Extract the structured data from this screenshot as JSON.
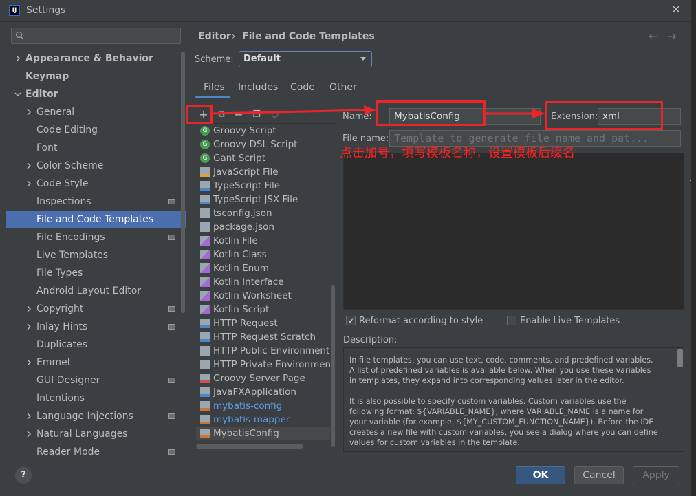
{
  "window": {
    "title": "Settings",
    "app_icon_text": "IJ"
  },
  "sidebar": {
    "search_placeholder": "",
    "items": [
      {
        "label": "Appearance & Behavior",
        "level": 0,
        "expandable": true,
        "expanded": false,
        "bold": true
      },
      {
        "label": "Keymap",
        "level": 0,
        "expandable": false,
        "bold": true
      },
      {
        "label": "Editor",
        "level": 0,
        "expandable": true,
        "expanded": true,
        "bold": true
      },
      {
        "label": "General",
        "level": 1,
        "expandable": true
      },
      {
        "label": "Code Editing",
        "level": 1
      },
      {
        "label": "Font",
        "level": 1
      },
      {
        "label": "Color Scheme",
        "level": 1,
        "expandable": true
      },
      {
        "label": "Code Style",
        "level": 1,
        "expandable": true
      },
      {
        "label": "Inspections",
        "level": 1,
        "project": true
      },
      {
        "label": "File and Code Templates",
        "level": 1,
        "selected": true
      },
      {
        "label": "File Encodings",
        "level": 1,
        "project": true
      },
      {
        "label": "Live Templates",
        "level": 1
      },
      {
        "label": "File Types",
        "level": 1
      },
      {
        "label": "Android Layout Editor",
        "level": 1
      },
      {
        "label": "Copyright",
        "level": 1,
        "expandable": true,
        "project": true
      },
      {
        "label": "Inlay Hints",
        "level": 1,
        "expandable": true,
        "project": true
      },
      {
        "label": "Duplicates",
        "level": 1
      },
      {
        "label": "Emmet",
        "level": 1,
        "expandable": true
      },
      {
        "label": "GUI Designer",
        "level": 1,
        "project": true
      },
      {
        "label": "Intentions",
        "level": 1
      },
      {
        "label": "Language Injections",
        "level": 1,
        "expandable": true,
        "project": true
      },
      {
        "label": "Natural Languages",
        "level": 1,
        "expandable": true
      },
      {
        "label": "Reader Mode",
        "level": 1,
        "project": true
      }
    ]
  },
  "breadcrumb": {
    "parent": "Editor",
    "separator": "›",
    "current": "File and Code Templates"
  },
  "nav": {
    "back": "←",
    "forward": "→"
  },
  "scheme": {
    "label": "Scheme:",
    "value": "Default"
  },
  "tabs": [
    "Files",
    "Includes",
    "Code",
    "Other"
  ],
  "active_tab": "Files",
  "toolbar": {
    "add": "+",
    "copy": "⧉",
    "remove": "−",
    "duplicate": "❐",
    "reset": "↺"
  },
  "templates": [
    {
      "label": "Groovy Script",
      "icon": "groovy-icon",
      "color": "#499c54"
    },
    {
      "label": "Groovy DSL Script",
      "icon": "groovy-icon",
      "color": "#499c54"
    },
    {
      "label": "Gant Script",
      "icon": "groovy-icon",
      "color": "#499c54"
    },
    {
      "label": "JavaScript File",
      "icon": "js-file-icon",
      "color": "#d9a343"
    },
    {
      "label": "TypeScript File",
      "icon": "ts-file-icon",
      "color": "#4a88c7"
    },
    {
      "label": "TypeScript JSX File",
      "icon": "tsx-file-icon",
      "color": "#4a88c7"
    },
    {
      "label": "tsconfig.json",
      "icon": "json-file-icon",
      "color": "#9aa7b0"
    },
    {
      "label": "package.json",
      "icon": "json-file-icon",
      "color": "#9aa7b0"
    },
    {
      "label": "Kotlin File",
      "icon": "kotlin-icon",
      "color": "#a36bd1"
    },
    {
      "label": "Kotlin Class",
      "icon": "kotlin-icon",
      "color": "#a36bd1"
    },
    {
      "label": "Kotlin Enum",
      "icon": "kotlin-icon",
      "color": "#a36bd1"
    },
    {
      "label": "Kotlin Interface",
      "icon": "kotlin-icon",
      "color": "#a36bd1"
    },
    {
      "label": "Kotlin Worksheet",
      "icon": "kotlin-icon",
      "color": "#a36bd1"
    },
    {
      "label": "Kotlin Script",
      "icon": "kotlin-icon",
      "color": "#a36bd1"
    },
    {
      "label": "HTTP Request",
      "icon": "http-api-icon",
      "color": "#4a88c7"
    },
    {
      "label": "HTTP Request Scratch",
      "icon": "http-api-icon",
      "color": "#4a88c7"
    },
    {
      "label": "HTTP Public Environment File",
      "icon": "http-env-icon",
      "color": "#9aa7b0"
    },
    {
      "label": "HTTP Private Environment File",
      "icon": "http-env-icon",
      "color": "#9aa7b0"
    },
    {
      "label": "Groovy Server Page",
      "icon": "gsp-icon",
      "color": "#c75450"
    },
    {
      "label": "JavaFXApplication",
      "icon": "javafx-icon",
      "color": "#4a88c7"
    },
    {
      "label": "mybatis-config",
      "icon": "xml-icon",
      "color": "#c7773a",
      "style": "blue"
    },
    {
      "label": "mybatis-mapper",
      "icon": "xml-icon",
      "color": "#c7773a",
      "style": "blue"
    },
    {
      "label": "MybatisConfig",
      "icon": "xml-icon",
      "color": "#c7773a",
      "selected": true
    }
  ],
  "form": {
    "name_label": "Name:",
    "name_value": "MybatisConfig",
    "extension_label": "Extension:",
    "extension_value": "xml",
    "file_name_label": "File name:",
    "file_name_placeholder": "Template to generate file name and pat..."
  },
  "options": {
    "reformat_label": "Reformat according to style",
    "reformat_checked": true,
    "live_templates_label": "Enable Live Templates",
    "live_templates_checked": false
  },
  "description": {
    "label": "Description:",
    "lines": [
      "In file templates, you can use text, code, comments, and predefined variables.",
      "A list of predefined variables is available below. When you use these variables",
      "in templates, they expand into corresponding values later in the editor.",
      "",
      "It is also possible to specify custom variables. Custom variables use the",
      "following format: ${VARIABLE_NAME}, where VARIABLE_NAME is a name for",
      "your variable (for example, ${MY_CUSTOM_FUNCTION_NAME}). Before the IDE",
      "creates a new file with custom variables, you see a dialog where you can define",
      "values for custom variables in the template."
    ]
  },
  "annotation": {
    "text": "点击加号，填写模板名称，设置模板后缀名",
    "color": "#e8262a"
  },
  "buttons": {
    "help": "?",
    "ok": "OK",
    "cancel": "Cancel",
    "apply": "Apply"
  },
  "colors": {
    "accent": "#4b6eaf",
    "background": "#3c3f41",
    "link": "#5f9be7",
    "ok": "#365880"
  }
}
